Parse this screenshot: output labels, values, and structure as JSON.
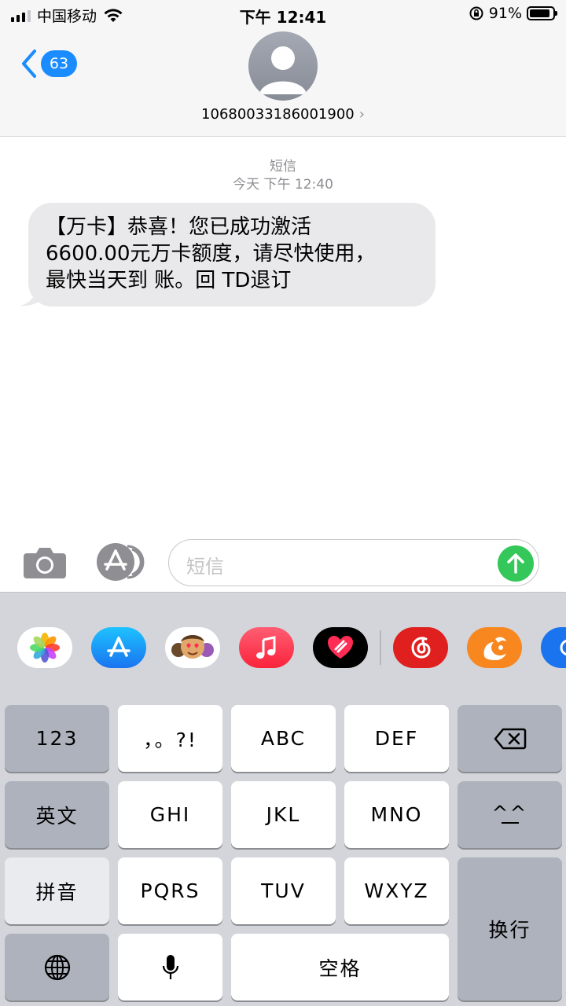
{
  "status_bar": {
    "carrier": "中国移动",
    "time": "下午 12:41",
    "battery_percent": "91%",
    "battery_level": 0.91
  },
  "header": {
    "back_count": "63",
    "contact_number": "10680033186001900",
    "contact_chevron": "›"
  },
  "conversation": {
    "service_label": "短信",
    "timestamp": "今天 下午 12:40",
    "messages": [
      {
        "lines": [
          "【万卡】恭喜！您已成功激活",
          "6600.00元万卡额度，请尽快使用，",
          "最快当天到 账。回 TD退订"
        ],
        "direction": "incoming"
      }
    ]
  },
  "composer": {
    "placeholder": "短信",
    "camera_icon": "camera-icon",
    "apps_icon": "app-store-icon",
    "send_icon": "arrow-up-icon"
  },
  "app_strip": {
    "apps": [
      "photos",
      "app-store",
      "memoji",
      "music",
      "digital-touch",
      "netease-music",
      "uc-browser",
      "partial-app"
    ]
  },
  "keyboard": {
    "keys": {
      "num": "123",
      "punct": "，。?!",
      "abc": "ABC",
      "def": "DEF",
      "english": "英文",
      "ghi": "GHI",
      "jkl": "JKL",
      "mno": "MNO",
      "emoticon": "^^",
      "pinyin": "拼音",
      "pqrs": "PQRS",
      "tuv": "TUV",
      "wxyz": "WXYZ",
      "return": "换行",
      "space": "空格"
    }
  },
  "colors": {
    "accent": "#1a8cff",
    "send": "#34c759",
    "bubble": "#e9e9eb",
    "keyboard_bg": "#d3d5da"
  }
}
